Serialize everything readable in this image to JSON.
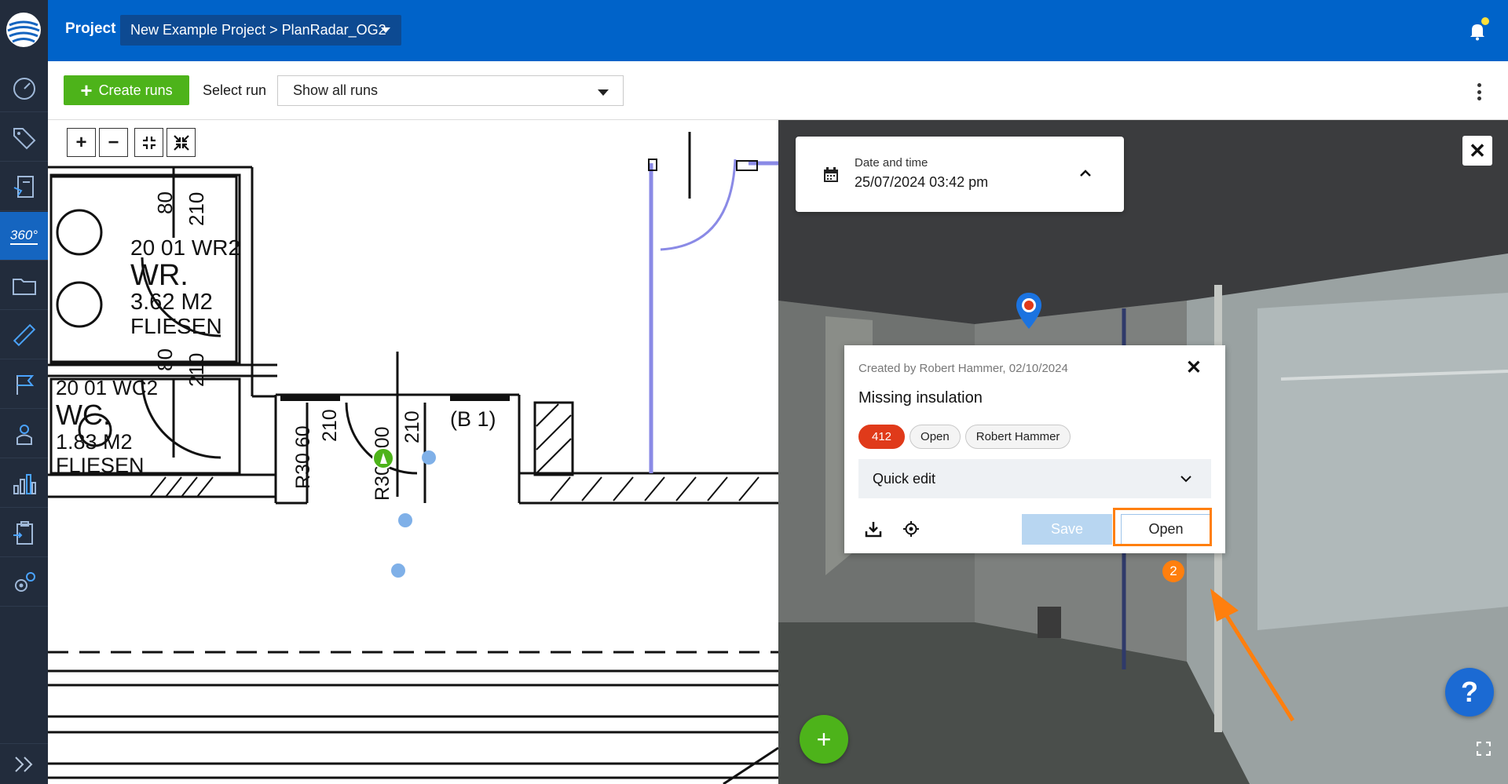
{
  "topbar": {
    "project_label": "Project",
    "project_selector": "New Example Project > PlanRadar_OG2"
  },
  "sidebar": {
    "items": [
      {
        "icon": "dashboard-icon"
      },
      {
        "icon": "tag-icon"
      },
      {
        "icon": "reports-icon"
      },
      {
        "icon": "360-icon",
        "label": "360°",
        "active": true
      },
      {
        "icon": "folder-icon"
      },
      {
        "icon": "ruler-icon"
      },
      {
        "icon": "flag-icon"
      },
      {
        "icon": "user-icon"
      },
      {
        "icon": "statistics-icon"
      },
      {
        "icon": "clipboard-icon"
      },
      {
        "icon": "settings-icon"
      }
    ]
  },
  "toolbar": {
    "create_runs_label": "Create runs",
    "select_run_label": "Select run",
    "run_select_value": "Show all runs"
  },
  "plan": {
    "room_texts": [
      "80",
      "210",
      "20 01 WR2",
      "WR.",
      "3.62 M2",
      "FLIESEN",
      "80",
      "210",
      "20 01 WC2",
      "WC.",
      "1.83 M2",
      "FLIESEN",
      "R30 60",
      "210",
      "R30 100",
      "210",
      "(B 1)"
    ]
  },
  "pano": {
    "date_label": "Date and time",
    "date_value": "25/07/2024 03:42 pm"
  },
  "ticket": {
    "created": "Created by Robert Hammer, 02/10/2024",
    "title": "Missing insulation",
    "tags": [
      "412",
      "Open",
      "Robert Hammer"
    ],
    "quick_edit": "Quick edit",
    "save_label": "Save",
    "open_label": "Open"
  },
  "annotation": {
    "step": "2"
  },
  "help_label": "?",
  "colors": {
    "topbar": "#0063c9",
    "sidebar": "#222c3c",
    "accent_green": "#4db31a",
    "ticket_tag": "#e03a1a",
    "highlight": "#ff7f0e"
  }
}
